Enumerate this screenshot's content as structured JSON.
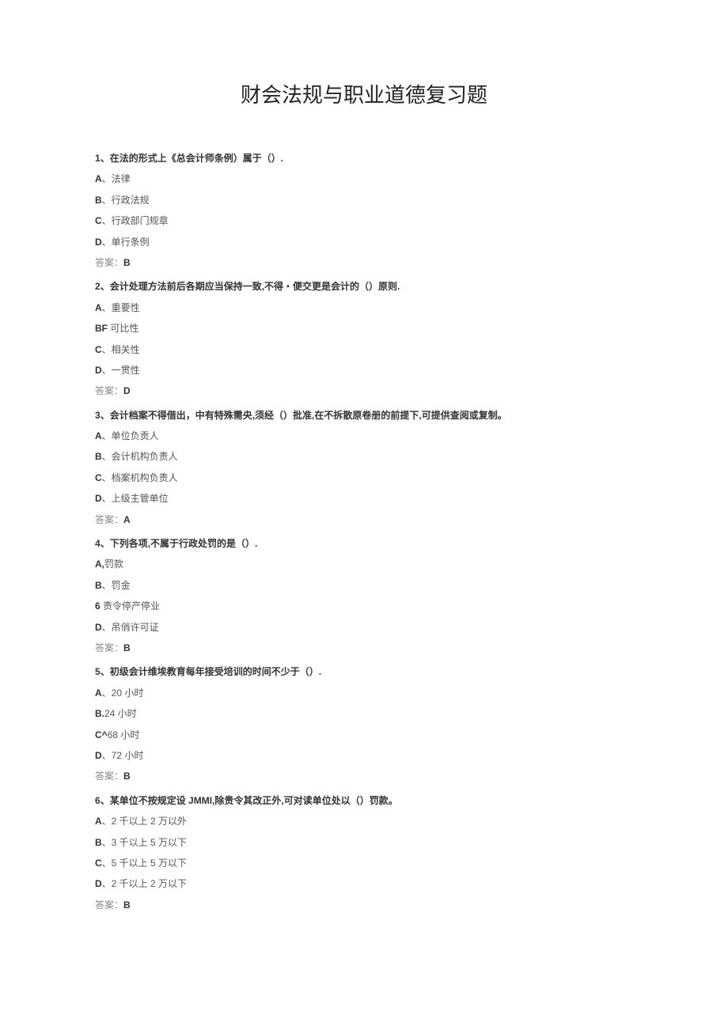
{
  "title": "财会法规与职业道德复习题",
  "answer_label": "答案：",
  "questions": [
    {
      "num": "1",
      "text": "、在法的形式上《总会计师条例）属于（）.",
      "options": [
        {
          "label": "A",
          "text": "、法律"
        },
        {
          "label": "B",
          "text": "、行政法规"
        },
        {
          "label": "C",
          "text": "、行政部门规章"
        },
        {
          "label": "D",
          "text": "、单行条例"
        }
      ],
      "answer": "B"
    },
    {
      "num": "2",
      "text": "、会计处理方法前后各期应当保持一致,不得・便交更是会计的（）原则.",
      "options": [
        {
          "label": "A",
          "text": "、重要性"
        },
        {
          "label": "BF",
          "text": " 可比性"
        },
        {
          "label": "C",
          "text": "、相关性"
        },
        {
          "label": "D",
          "text": "、一贯性"
        }
      ],
      "answer": "D"
    },
    {
      "num": "3",
      "text": "、会计档案不得借出，中有特殊需央,须经（）批准,在不拆散原卷册的前提下,可提供查阅或复制。",
      "options": [
        {
          "label": "A",
          "text": "、单位负贡人"
        },
        {
          "label": "B",
          "text": "、会计机构负责人"
        },
        {
          "label": "C",
          "text": "、档案机构负责人"
        },
        {
          "label": "D",
          "text": "、上级主管单位"
        }
      ],
      "answer": "A"
    },
    {
      "num": "4",
      "text": "、下列各项,不属于行政处罚的是（）.",
      "options": [
        {
          "label": "A,",
          "text": "罚款"
        },
        {
          "label": "B",
          "text": "、罚金"
        },
        {
          "label": "6",
          "text": " 责令停产停业"
        },
        {
          "label": "D",
          "text": "、吊俏许可证"
        }
      ],
      "answer": "B"
    },
    {
      "num": "5",
      "text": "、初级会计维埃教育每年接受培训的时间不少于（）.",
      "options": [
        {
          "label": "A",
          "text": "、20 小时"
        },
        {
          "label": "B.",
          "text": "24 小时"
        },
        {
          "label": "C^",
          "text": "68 小时"
        },
        {
          "label": "D",
          "text": "、72 小时"
        }
      ],
      "answer": "B"
    },
    {
      "num": "6",
      "text": "、某单位不按规定设 JMMI,除贵令其改正外,可对读单位处以（）罚款。",
      "options": [
        {
          "label": "A",
          "text": "、2 千以上 2 万以外"
        },
        {
          "label": "B",
          "text": "、3 千以上 5 万以下"
        },
        {
          "label": "C",
          "text": "、5 千以上 5 万以下"
        },
        {
          "label": "D",
          "text": "、2 千以上 2 万以下"
        }
      ],
      "answer": "B"
    }
  ]
}
